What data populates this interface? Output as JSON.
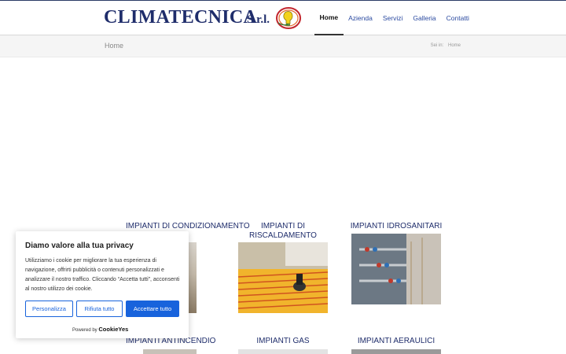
{
  "logo": {
    "name": "CLIMATECNICA",
    "suffix": "S.r.l."
  },
  "nav": {
    "items": [
      {
        "label": "Home"
      },
      {
        "label": "Azienda"
      },
      {
        "label": "Servizi"
      },
      {
        "label": "Galleria"
      },
      {
        "label": "Contatti"
      }
    ]
  },
  "breadcrumb": {
    "title": "Home",
    "prefix": "Sei in:",
    "current": "Home"
  },
  "services": [
    {
      "title": "IMPIANTI DI CONDIZIONAMENTO"
    },
    {
      "title_line1": "IMPIANTI DI",
      "title_line2": "RISCALDAMENTO"
    },
    {
      "title": "IMPIANTI IDROSANITARI"
    },
    {
      "title": "IMPIANTI ANTINCENDIO"
    },
    {
      "title": "IMPIANTI GAS"
    },
    {
      "title": "IMPIANTI AERAULICI"
    }
  ],
  "cookie": {
    "title": "Diamo valore alla tua privacy",
    "text": "Utilizziamo i cookie per migliorare la tua esperienza di navigazione, offrirti pubblicità o contenuti personalizzati e analizzare il nostro traffico. Cliccando “Accetta tutti”, acconsenti al nostro utilizzo dei cookie.",
    "customize": "Personalizza",
    "reject": "Rifiuta tutto",
    "accept": "Accettare tutto",
    "powered_by": "Powered by",
    "brand": "CookieYes"
  },
  "colors": {
    "brand_navy": "#1f2d6b",
    "link_blue": "#2b4aa0",
    "cookie_blue": "#1863dc"
  }
}
